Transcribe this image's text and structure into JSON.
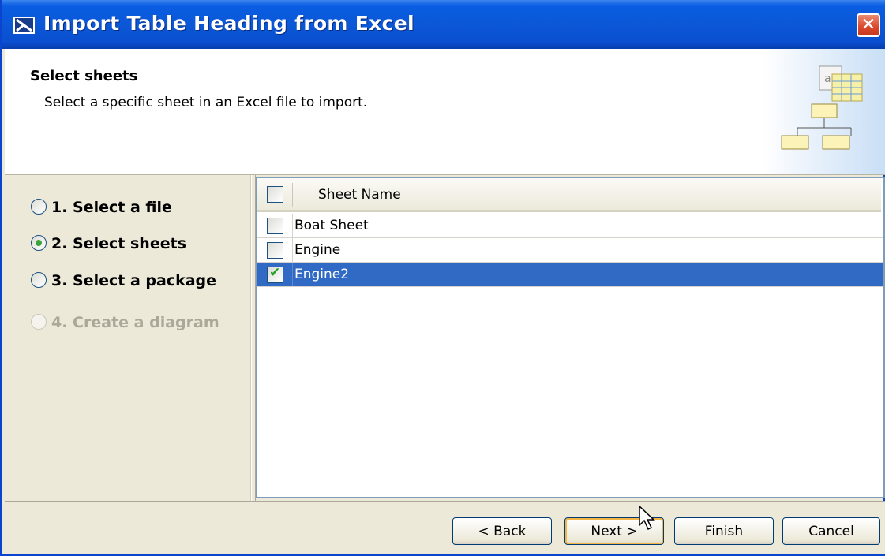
{
  "window": {
    "title": "Import Table Heading from Excel",
    "close_glyph": "✕"
  },
  "header": {
    "title": "Select sheets",
    "subtitle": "Select a specific sheet in an Excel file to import.",
    "graphic_icon": "wizard-diagram-icon"
  },
  "steps": [
    {
      "label": "1. Select a file",
      "state": "enabled"
    },
    {
      "label": "2. Select sheets",
      "state": "current"
    },
    {
      "label": "3. Select a package",
      "state": "enabled"
    },
    {
      "label": "4. Create a diagram",
      "state": "disabled"
    }
  ],
  "table": {
    "header_label": "Sheet Name",
    "header_checked": false,
    "rows": [
      {
        "name": "Boat Sheet",
        "checked": false,
        "selected": false
      },
      {
        "name": "Engine",
        "checked": false,
        "selected": false
      },
      {
        "name": "Engine2",
        "checked": true,
        "selected": true
      }
    ]
  },
  "buttons": {
    "back": "< Back",
    "next": "Next >",
    "finish": "Finish",
    "cancel": "Cancel"
  },
  "colors": {
    "titlebar": "#0a5de2",
    "selection": "#316ac5",
    "check": "#21a121"
  }
}
